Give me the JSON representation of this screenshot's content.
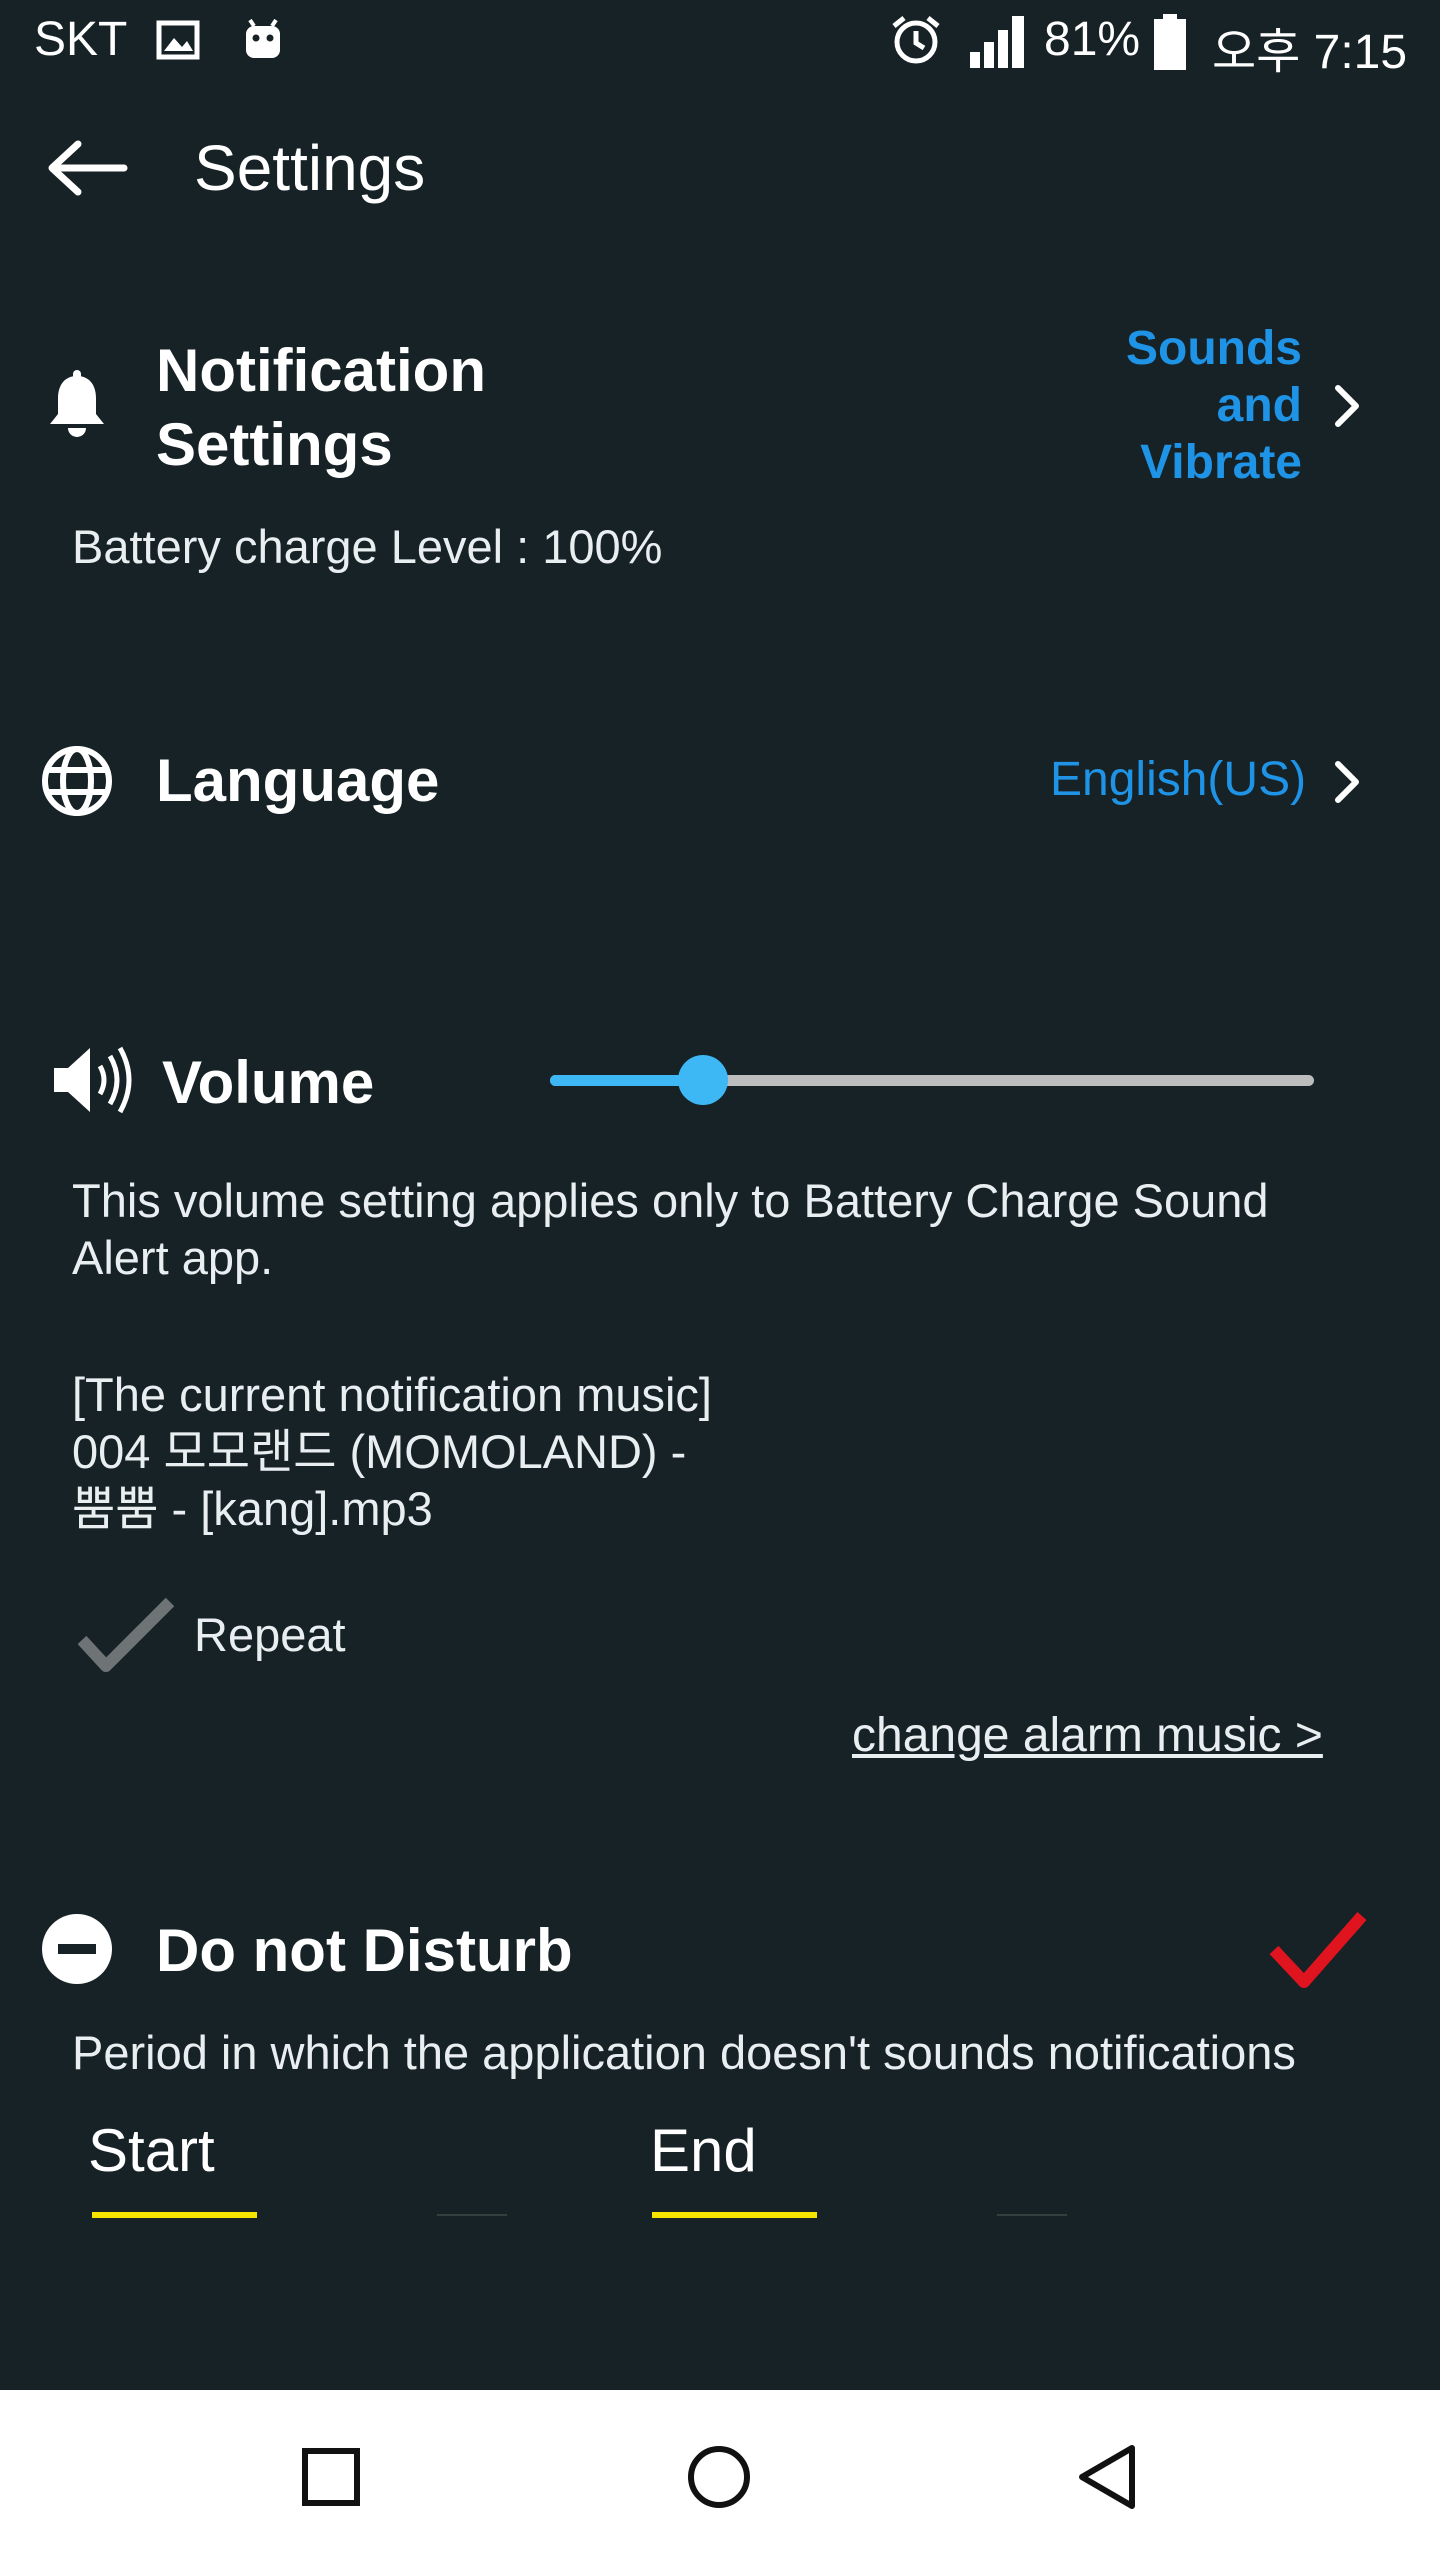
{
  "status_bar": {
    "carrier": "SKT",
    "battery_percent": "81%",
    "time": "오후 7:15",
    "icons": [
      "image-icon",
      "android-icon",
      "alarm-icon",
      "signal-icon",
      "battery-icon"
    ]
  },
  "header": {
    "title": "Settings",
    "back_icon": "back-arrow-icon"
  },
  "notification": {
    "title_line1": "Notification",
    "title_line2": "Settings",
    "link_line1": "Sounds",
    "link_line2": "and",
    "link_line3": "Vibrate",
    "battery_level_text": "Battery charge Level : 100%"
  },
  "language": {
    "title": "Language",
    "value": "English(US)"
  },
  "volume": {
    "title": "Volume",
    "level_fraction": 0.2,
    "description_line1": "This volume setting applies only to Battery Charge Sound",
    "description_line2": "Alert app.",
    "music_label": "[The current notification music]",
    "music_line1": "004 모모랜드 (MOMOLAND) -",
    "music_line2": "뿜뿜 - [kang].mp3",
    "repeat_label": "Repeat",
    "repeat_checked": true,
    "change_music_link": "change alarm music >"
  },
  "dnd": {
    "title": "Do not Disturb",
    "enabled": true,
    "description": "Period in which the application doesn't sounds notifications",
    "start_label": "Start",
    "end_label": "End"
  },
  "colors": {
    "background": "#172226",
    "accent_blue": "#1f93e6",
    "slider_blue": "#3db8f5",
    "check_red": "#e0141e",
    "time_yellow": "#f5e400"
  }
}
